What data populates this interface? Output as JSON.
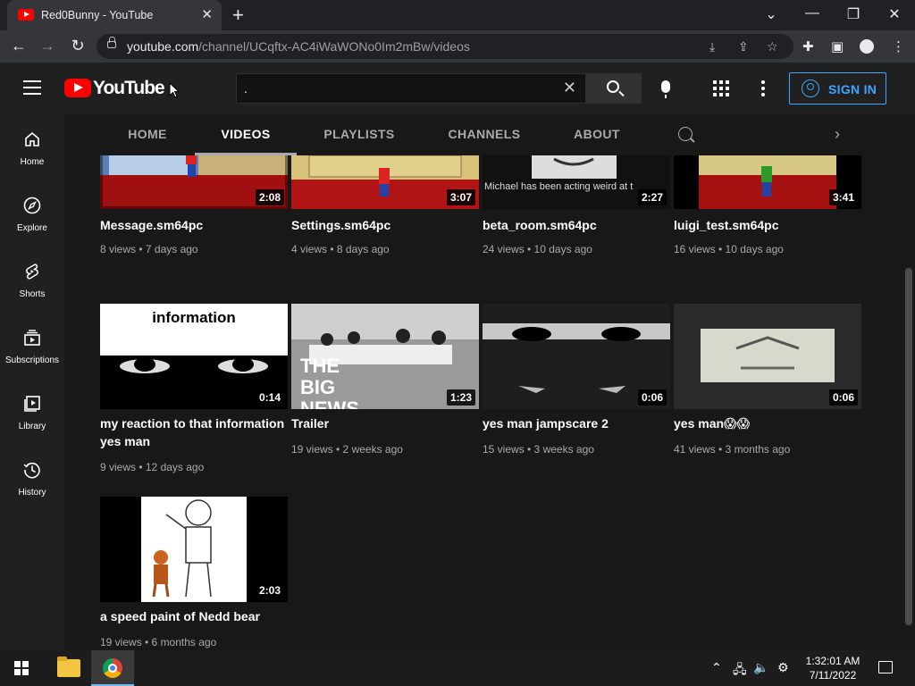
{
  "browser": {
    "tab_title": "Red0Bunny - YouTube",
    "new_tab_glyph": "+",
    "close_glyph": "✕",
    "url_host": "youtube.com",
    "url_path": "/channel/UCqftx-AC4iWaWONo0Im2mBw/videos",
    "window_controls": {
      "dropdown": "⌄",
      "minimize": "—",
      "restore": "❐",
      "close": "✕"
    }
  },
  "masthead": {
    "logo_text": "YouTube",
    "search_value": ".",
    "sign_in": "SIGN IN"
  },
  "sidebar": {
    "items": [
      {
        "label": "Home",
        "icon": "home-icon"
      },
      {
        "label": "Explore",
        "icon": "compass-icon"
      },
      {
        "label": "Shorts",
        "icon": "shorts-icon"
      },
      {
        "label": "Subscriptions",
        "icon": "subscriptions-icon"
      },
      {
        "label": "Library",
        "icon": "library-icon"
      },
      {
        "label": "History",
        "icon": "history-icon"
      }
    ]
  },
  "channel_tabs": [
    {
      "label": "HOME",
      "selected": false
    },
    {
      "label": "VIDEOS",
      "selected": true
    },
    {
      "label": "PLAYLISTS",
      "selected": false
    },
    {
      "label": "CHANNELS",
      "selected": false
    },
    {
      "label": "ABOUT",
      "selected": false
    }
  ],
  "videos": [
    {
      "title": "Message.sm64pc",
      "meta": "8 views • 7 days ago",
      "duration": "2:08"
    },
    {
      "title": "Settings.sm64pc",
      "meta": "4 views • 8 days ago",
      "duration": "3:07"
    },
    {
      "title": "beta_room.sm64pc",
      "meta": "24 views • 10 days ago",
      "duration": "2:27",
      "thumb_caption": "Michael has been acting weird at t"
    },
    {
      "title": "luigi_test.sm64pc",
      "meta": "16 views • 10 days ago",
      "duration": "3:41"
    },
    {
      "title": "my reaction to that information yes man",
      "meta": "9 views • 12 days ago",
      "duration": "0:14",
      "thumb_caption": "information"
    },
    {
      "title": "Trailer",
      "meta": "19 views • 2 weeks ago",
      "duration": "1:23",
      "thumb_caption": "THE BIG NEWS"
    },
    {
      "title": "yes man jampscare 2",
      "meta": "15 views • 3 weeks ago",
      "duration": "0:06"
    },
    {
      "title": "yes man😱😱",
      "meta": "41 views • 3 months ago",
      "duration": "0:06"
    },
    {
      "title": "a speed paint of Nedd bear",
      "meta": "19 views • 6 months ago",
      "duration": "2:03"
    }
  ],
  "taskbar": {
    "time": "1:32:01 AM",
    "date": "7/11/2022"
  },
  "colors": {
    "accent": "#3ea6ff",
    "brand_red": "#ff0000",
    "background": "#181818"
  }
}
